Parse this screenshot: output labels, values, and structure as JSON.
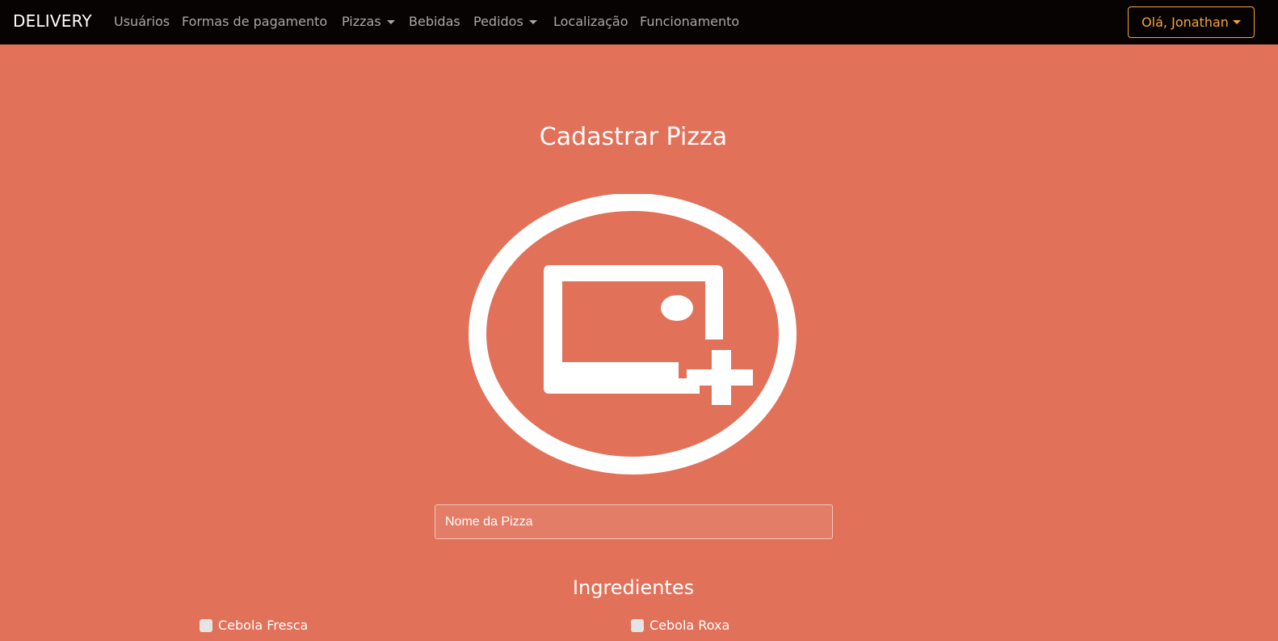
{
  "navbar": {
    "brand": "DELIVERY",
    "items": [
      {
        "label": "Usuários",
        "dropdown": false
      },
      {
        "label": "Formas de pagamento",
        "dropdown": false
      },
      {
        "label": "Pizzas",
        "dropdown": true
      },
      {
        "label": "Bebidas",
        "dropdown": false
      },
      {
        "label": "Pedidos",
        "dropdown": true
      },
      {
        "label": "Localização",
        "dropdown": false
      },
      {
        "label": "Funcionamento",
        "dropdown": false
      }
    ],
    "user_menu": "Olá, Jonathan"
  },
  "form": {
    "title": "Cadastrar Pizza",
    "image_icon": "add-image-icon",
    "name_placeholder": "Nome da Pizza",
    "name_value": ""
  },
  "ingredients": {
    "title": "Ingredientes",
    "items": [
      {
        "label": "Cebola Fresca",
        "checked": false
      },
      {
        "label": "Cebola Roxa",
        "checked": false
      }
    ]
  },
  "colors": {
    "background": "#e2715a",
    "navbar": "#070303",
    "accent": "#f2a53a",
    "text": "#ffffff"
  }
}
